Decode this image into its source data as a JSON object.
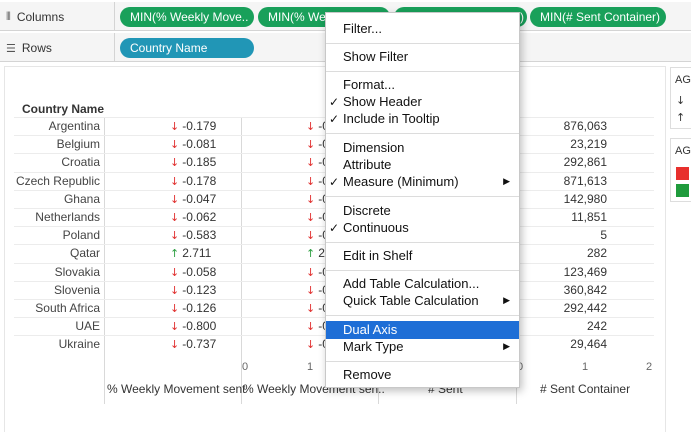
{
  "shelves": {
    "columns": {
      "label": "Columns",
      "icon": "columns-icon",
      "pills": [
        "MIN(% Weekly Move..",
        "MIN(% Weekly Mo..",
        "MIN(# Sent Container)",
        "MIN(# Sent Container)"
      ]
    },
    "rows": {
      "label": "Rows",
      "icon": "rows-icon",
      "pills": [
        "Country Name"
      ]
    }
  },
  "table": {
    "row_header_title": "Country Name",
    "countries": [
      "Argentina",
      "Belgium",
      "Croatia",
      "Czech Republic",
      "Ghana",
      "Netherlands",
      "Poland",
      "Qatar",
      "Slovakia",
      "Slovenia",
      "South Africa",
      "UAE",
      "Ukraine"
    ],
    "weekly_movement": [
      "-0.179",
      "-0.081",
      "-0.185",
      "-0.178",
      "-0.047",
      "-0.062",
      "-0.583",
      "2.711",
      "-0.058",
      "-0.123",
      "-0.126",
      "-0.800",
      "-0.737"
    ],
    "weekly_movement_col2_prefix": [
      "-0",
      "-0",
      "-0",
      "-0",
      "-0",
      "-0",
      "-0",
      "2",
      "-0",
      "-0",
      "-0",
      "-0",
      "-0"
    ],
    "sent_container": [
      "876,063",
      "23,219",
      "292,861",
      "871,613",
      "142,980",
      "11,851",
      "5",
      "282",
      "123,469",
      "360,842",
      "292,442",
      "242",
      "29,464"
    ],
    "direction": [
      "down",
      "down",
      "down",
      "down",
      "down",
      "down",
      "down",
      "up",
      "down",
      "down",
      "down",
      "down",
      "down"
    ]
  },
  "axis": {
    "col2_ticks": [
      "0",
      "1"
    ],
    "col4_ticks": [
      "0",
      "1",
      "2"
    ]
  },
  "column_footers": [
    "% Weekly Movement sent",
    "% Weekly Movement sen..",
    "# Sent",
    "# Sent  Container"
  ],
  "legends": [
    {
      "title": "AG",
      "glyphs": [
        "↓",
        "↑"
      ]
    },
    {
      "title": "AG",
      "swatches": [
        "#e8302d",
        "#1f9b3c"
      ]
    }
  ],
  "context_menu": {
    "items": [
      {
        "label": "Filter...",
        "checked": false,
        "submenu": false
      },
      {
        "label": "Show Filter",
        "checked": false,
        "submenu": false
      },
      {
        "label": "Format...",
        "checked": false,
        "submenu": false
      },
      {
        "label": "Show Header",
        "checked": true,
        "submenu": false
      },
      {
        "label": "Include in Tooltip",
        "checked": true,
        "submenu": false
      },
      {
        "label": "Dimension",
        "checked": false,
        "submenu": false
      },
      {
        "label": "Attribute",
        "checked": false,
        "submenu": false
      },
      {
        "label": "Measure (Minimum)",
        "checked": true,
        "submenu": true
      },
      {
        "label": "Discrete",
        "checked": false,
        "submenu": false
      },
      {
        "label": "Continuous",
        "checked": true,
        "submenu": false
      },
      {
        "label": "Edit in Shelf",
        "checked": false,
        "submenu": false
      },
      {
        "label": "Add Table Calculation...",
        "checked": false,
        "submenu": false
      },
      {
        "label": "Quick Table Calculation",
        "checked": false,
        "submenu": true
      },
      {
        "label": "Dual Axis",
        "checked": false,
        "submenu": false,
        "highlighted": true
      },
      {
        "label": "Mark Type",
        "checked": false,
        "submenu": true
      },
      {
        "label": "Remove",
        "checked": false,
        "submenu": false
      }
    ]
  },
  "colors": {
    "pill_green": "#19a05a",
    "pill_blue": "#2196b6",
    "arrow_down": "#e0302f",
    "arrow_up": "#2ea043",
    "menu_highlight": "#1e6ed6"
  }
}
